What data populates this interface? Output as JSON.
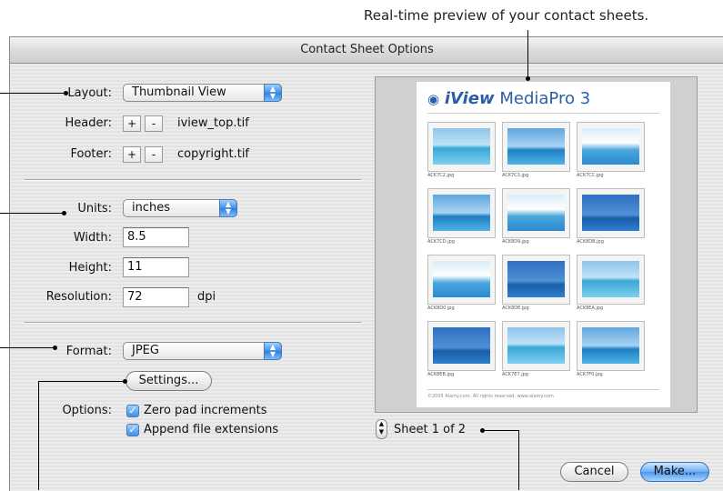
{
  "callout_top": "Real-time preview of your contact sheets.",
  "window": {
    "title": "Contact Sheet Options"
  },
  "layout": {
    "label": "Layout:",
    "value": "Thumbnail View"
  },
  "header": {
    "label": "Header:",
    "plus": "+",
    "minus": "-",
    "file": "iview_top.tif"
  },
  "footer": {
    "label": "Footer:",
    "plus": "+",
    "minus": "-",
    "file": "copyright.tif"
  },
  "units": {
    "label": "Units:",
    "value": "inches"
  },
  "width": {
    "label": "Width:",
    "value": "8.5"
  },
  "height": {
    "label": "Height:",
    "value": "11"
  },
  "resolution": {
    "label": "Resolution:",
    "value": "72",
    "unit": "dpi"
  },
  "format": {
    "label": "Format:",
    "value": "JPEG"
  },
  "settings_button": "Settings...",
  "options": {
    "label": "Options:",
    "zero_pad": {
      "label": "Zero pad increments",
      "checked": true
    },
    "append_ext": {
      "label": "Append file extensions",
      "checked": true
    }
  },
  "preview": {
    "logo_brand": "iView",
    "logo_product": "MediaPro 3",
    "captions": [
      "ACK7C2.jpg",
      "ACK7C3.jpg",
      "ACK7CC.jpg",
      "ACK7CD.jpg",
      "ACK8D9.jpg",
      "ACK8DB.jpg",
      "ACK8D0.jpg",
      "ACK8DE.jpg",
      "ACK8EA.jpg",
      "ACK8EB.jpg",
      "ACK7E7.jpg",
      "ACK7F0.jpg"
    ],
    "footer_text": "©2005 Alamy.com. All rights reserved. www.alamy.com"
  },
  "sheet_counter": "Sheet 1 of 2",
  "cancel_button": "Cancel",
  "make_button": "Make...",
  "colors": {
    "accent": "#3f8fe6",
    "window_bg": "#e8e8e8"
  }
}
